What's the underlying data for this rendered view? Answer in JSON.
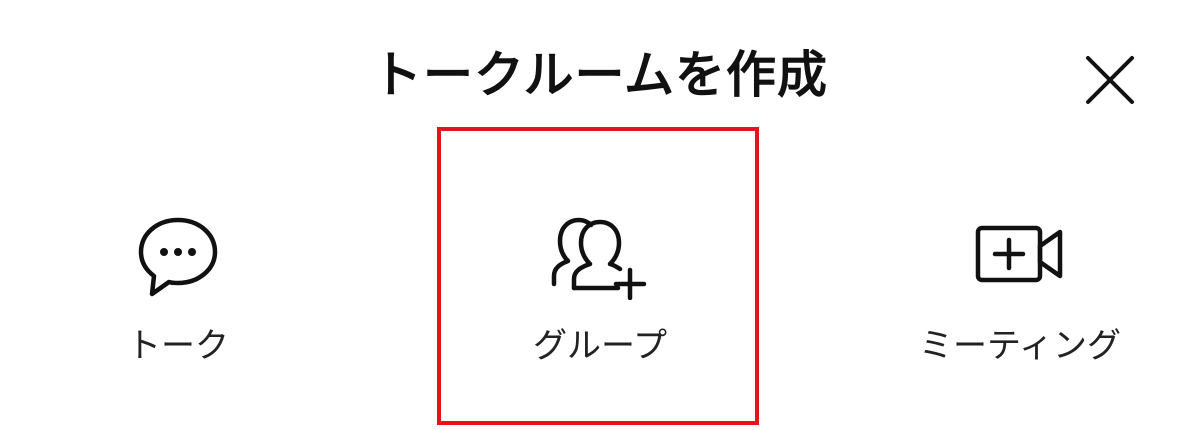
{
  "dialog": {
    "title": "トークルームを作成"
  },
  "options": [
    {
      "label": "トーク",
      "icon": "chat-bubble-icon"
    },
    {
      "label": "グループ",
      "icon": "add-group-icon"
    },
    {
      "label": "ミーティング",
      "icon": "video-add-icon"
    }
  ],
  "colors": {
    "highlight": "#e5131d",
    "text": "#111111"
  }
}
